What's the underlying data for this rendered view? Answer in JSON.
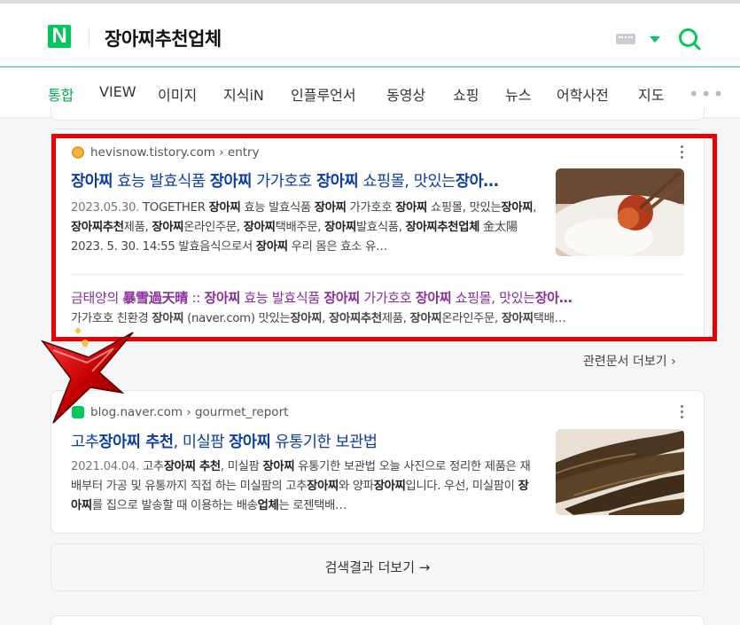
{
  "header": {
    "query": "장아찌추천업체",
    "logo_letter": "N"
  },
  "tabs": [
    {
      "label": "통합",
      "active": true
    },
    {
      "label": "VIEW"
    },
    {
      "label": "이미지"
    },
    {
      "label": "지식iN"
    },
    {
      "label": "인플루언서"
    },
    {
      "label": "동영상"
    },
    {
      "label": "쇼핑"
    },
    {
      "label": "뉴스"
    },
    {
      "label": "어학사전"
    },
    {
      "label": "지도"
    }
  ],
  "results": [
    {
      "source": "hevisnow.tistory.com › entry",
      "title_parts": [
        {
          "t": "장아찌",
          "b": true
        },
        {
          "t": " 효능 발효식품 "
        },
        {
          "t": "장아찌",
          "b": true
        },
        {
          "t": " 가가호호 "
        },
        {
          "t": "장아찌",
          "b": true
        },
        {
          "t": " 쇼핑몰, 맛있는"
        },
        {
          "t": "장아…",
          "b": true
        }
      ],
      "date": "2023.05.30.",
      "body_parts": [
        {
          "t": "  TOGETHER "
        },
        {
          "t": "장아찌",
          "b": true
        },
        {
          "t": " 효능 발효식품 "
        },
        {
          "t": "장아찌",
          "b": true
        },
        {
          "t": " 가가호호 "
        },
        {
          "t": "장아찌",
          "b": true
        },
        {
          "t": " 쇼핑몰, 맛있는"
        },
        {
          "t": "장아찌",
          "b": true
        },
        {
          "t": ", "
        },
        {
          "t": "장아찌추천",
          "b": true
        },
        {
          "t": "제품, "
        },
        {
          "t": "장아찌",
          "b": true
        },
        {
          "t": "온라인주문, "
        },
        {
          "t": "장아찌",
          "b": true
        },
        {
          "t": "택배주문, "
        },
        {
          "t": "장아찌",
          "b": true
        },
        {
          "t": "발효식품, "
        },
        {
          "t": "장아찌추천업체",
          "b": true
        },
        {
          "t": " 金太陽 2023. 5. 30. 14:55 발효음식으로서 "
        },
        {
          "t": "장아찌",
          "b": true
        },
        {
          "t": " 우리 몸은 효소 유…"
        }
      ],
      "sub_title_parts": [
        {
          "t": "금태양의 "
        },
        {
          "t": "暴雪過天晴",
          "b": true
        },
        {
          "t": " :: "
        },
        {
          "t": "장아찌",
          "b": true
        },
        {
          "t": " 효능 발효식품 "
        },
        {
          "t": "장아찌",
          "b": true
        },
        {
          "t": " 가가호호 "
        },
        {
          "t": "장아찌",
          "b": true
        },
        {
          "t": " 쇼핑몰, 맛있는"
        },
        {
          "t": "장아…",
          "b": true
        }
      ],
      "sub_body_parts": [
        {
          "t": "가가호호 친환경 "
        },
        {
          "t": "장아찌",
          "b": true
        },
        {
          "t": " (naver.com) 맛있는"
        },
        {
          "t": "장아찌",
          "b": true
        },
        {
          "t": ", "
        },
        {
          "t": "장아찌추천",
          "b": true
        },
        {
          "t": "제품, "
        },
        {
          "t": "장아찌",
          "b": true
        },
        {
          "t": "온라인주문, "
        },
        {
          "t": "장아찌",
          "b": true
        },
        {
          "t": "택배…"
        }
      ]
    },
    {
      "source": "blog.naver.com › gourmet_report",
      "title_parts": [
        {
          "t": "고추"
        },
        {
          "t": "장아찌 추천",
          "b": true
        },
        {
          "t": ", 미실팜 "
        },
        {
          "t": "장아찌",
          "b": true
        },
        {
          "t": " 유통기한 보관법"
        }
      ],
      "date": "2021.04.04.",
      "body_parts": [
        {
          "t": "  고추"
        },
        {
          "t": "장아찌 추천",
          "b": true
        },
        {
          "t": ", 미실팜 "
        },
        {
          "t": "장아찌",
          "b": true
        },
        {
          "t": " 유통기한 보관법 오늘 사진으로 정리한 제품은 재배부터 가공 및 유통까지 직접 하는 미실팜의 고추"
        },
        {
          "t": "장아찌",
          "b": true
        },
        {
          "t": "와 양파"
        },
        {
          "t": "장아찌",
          "b": true
        },
        {
          "t": "입니다. 우선, 미실팜이 "
        },
        {
          "t": "장아찌",
          "b": true
        },
        {
          "t": "를 집으로 발송할 때 이용하는 배송"
        },
        {
          "t": "업체",
          "b": true
        },
        {
          "t": "는 로젠택배…"
        }
      ]
    }
  ],
  "related_more": "관련문서 더보기",
  "more_results": "검색결과 더보기",
  "colors": {
    "brand": "#03c75a",
    "highlight": "#e60000",
    "title": "#0b3ca8",
    "sub_title": "#8a2d9d"
  },
  "icons": [
    "search-icon",
    "keyboard-icon",
    "more-dots-icon",
    "kebab-icon",
    "chevron-right-icon",
    "arrow-right-icon"
  ]
}
